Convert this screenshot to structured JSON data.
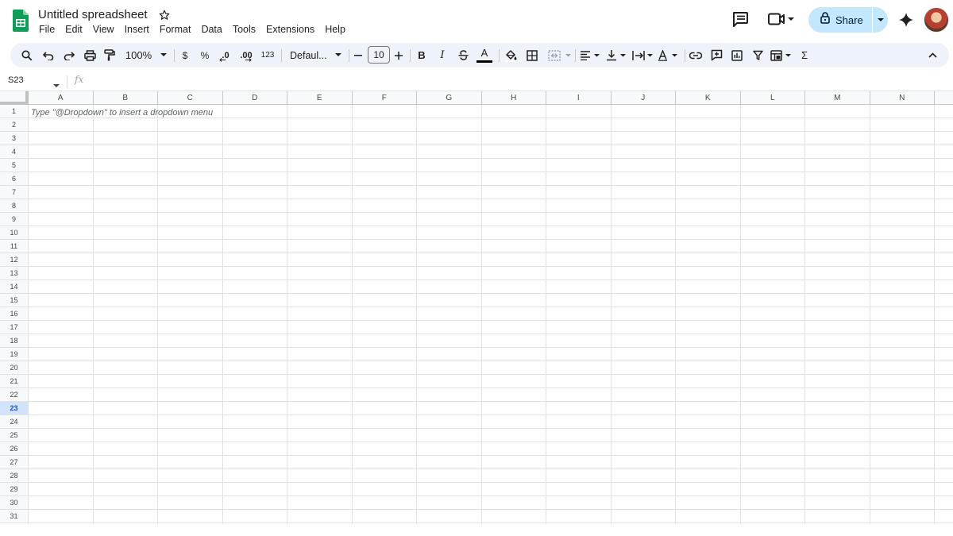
{
  "document": {
    "title": "Untitled spreadsheet"
  },
  "menu": [
    "File",
    "Edit",
    "View",
    "Insert",
    "Format",
    "Data",
    "Tools",
    "Extensions",
    "Help"
  ],
  "share": {
    "label": "Share"
  },
  "toolbar": {
    "zoom": "100%",
    "currency": "$",
    "percent": "%",
    "decrease_decimals": ".0",
    "increase_decimals": ".00",
    "more_formats": "123",
    "font_family": "Defaul...",
    "font_size": "10",
    "bold": "B",
    "italic": "I",
    "text_color_glyph": "A",
    "sum_glyph": "Σ"
  },
  "formula_bar": {
    "name_box": "S23",
    "fx_label": "fx"
  },
  "grid": {
    "columns": [
      "A",
      "B",
      "C",
      "D",
      "E",
      "F",
      "G",
      "H",
      "I",
      "J",
      "K",
      "L",
      "M",
      "N"
    ],
    "rows": [
      "1",
      "2",
      "3",
      "4",
      "5",
      "6",
      "7",
      "8",
      "9",
      "10",
      "11",
      "12",
      "13",
      "14",
      "15",
      "16",
      "17",
      "18",
      "19",
      "20",
      "21",
      "22",
      "23",
      "24",
      "25",
      "26",
      "27",
      "28",
      "29",
      "30",
      "31"
    ],
    "active_row": "23",
    "cell_hint": "Type \"@Dropdown\"  to insert a dropdown menu"
  },
  "colors": {
    "accent": "#0b57d0",
    "share_bg": "#c2e7ff",
    "toolbar_bg": "#eef2f9",
    "sheets_green": "#0f9d58"
  }
}
